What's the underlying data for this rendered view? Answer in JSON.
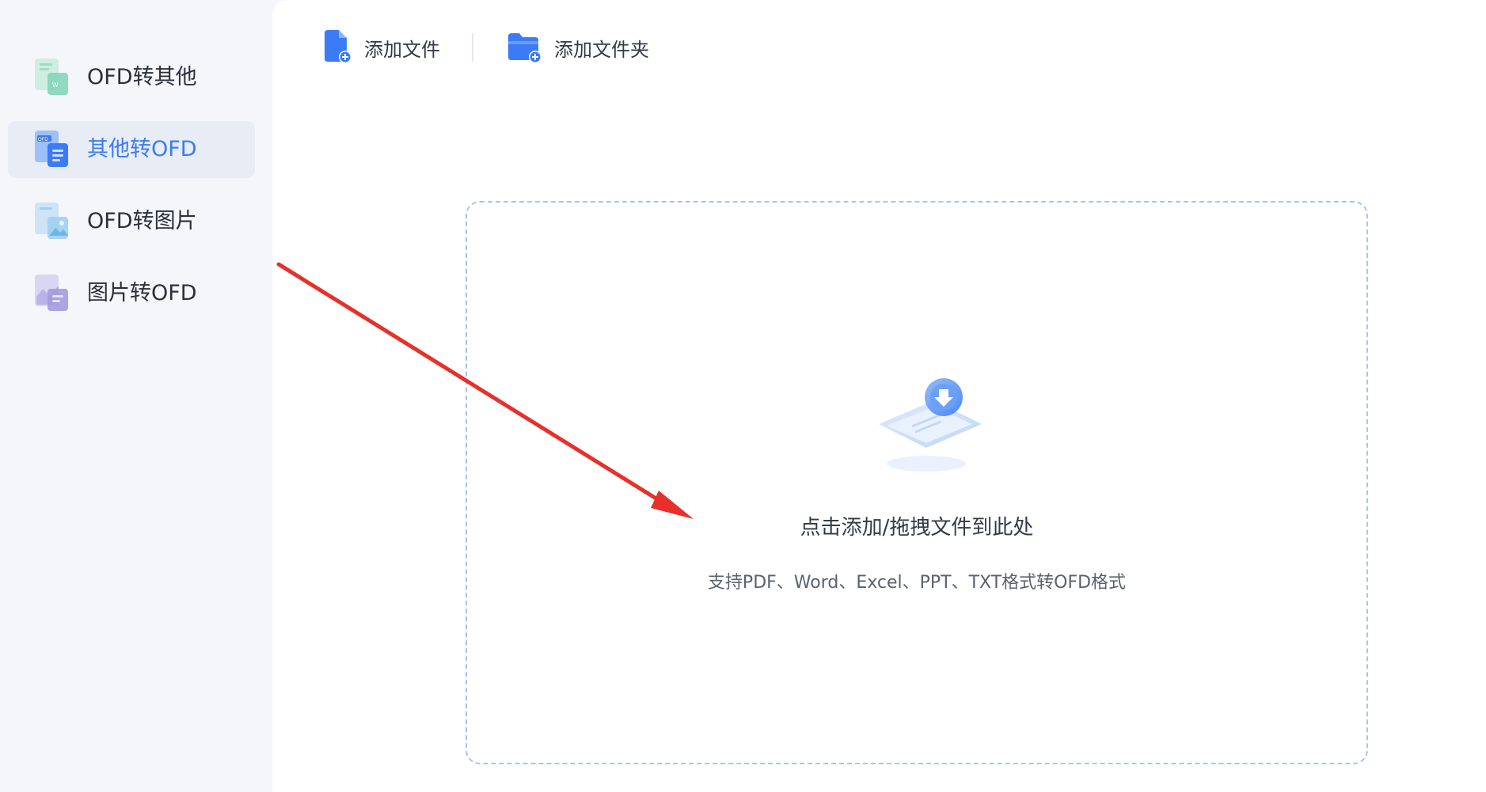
{
  "sidebar": {
    "items": [
      {
        "label": "OFD转其他",
        "icon": "ofd-to-other-icon",
        "active": false
      },
      {
        "label": "其他转OFD",
        "icon": "other-to-ofd-icon",
        "active": true
      },
      {
        "label": "OFD转图片",
        "icon": "ofd-to-image-icon",
        "active": false
      },
      {
        "label": "图片转OFD",
        "icon": "image-to-ofd-icon",
        "active": false
      }
    ]
  },
  "toolbar": {
    "add_file_label": "添加文件",
    "add_folder_label": "添加文件夹"
  },
  "dropzone": {
    "title": "点击添加/拖拽文件到此处",
    "subtitle": "支持PDF、Word、Excel、PPT、TXT格式转OFD格式",
    "icon": "upload-download-icon"
  },
  "colors": {
    "accent": "#3b7bf6",
    "annotation_arrow": "#e8302a",
    "dropzone_border": "#a9c3ee"
  }
}
